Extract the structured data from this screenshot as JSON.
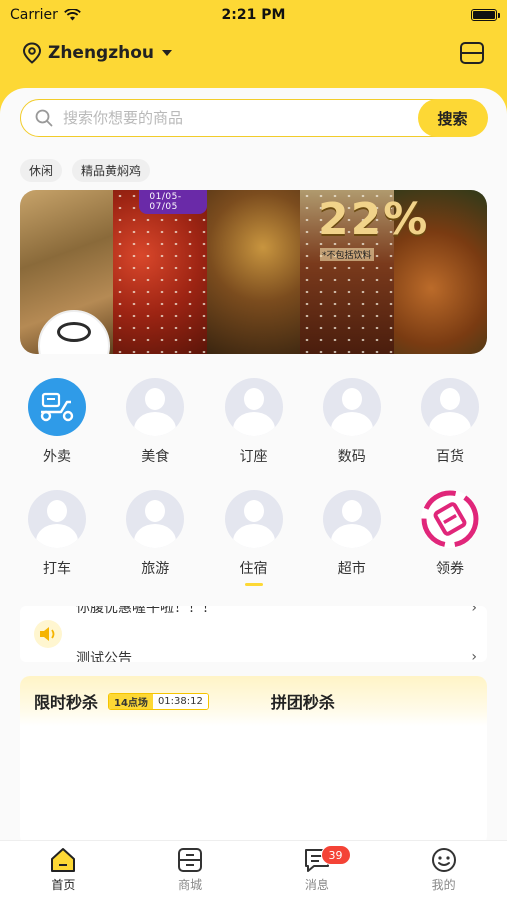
{
  "status_bar": {
    "carrier": "Carrier",
    "time": "2:21 PM"
  },
  "header": {
    "location": "Zhengzhou"
  },
  "search": {
    "placeholder": "搜索你想要的商品",
    "button_label": "搜索"
  },
  "tags": [
    "休闲",
    "精品黄焖鸡"
  ],
  "banner": {
    "date_range": "01/05-07/05",
    "discount": "22%",
    "discount_note": "*不包括饮料"
  },
  "categories": [
    {
      "label": "外卖",
      "icon": "scooter-icon"
    },
    {
      "label": "美食",
      "icon": "avatar-placeholder"
    },
    {
      "label": "订座",
      "icon": "avatar-placeholder"
    },
    {
      "label": "数码",
      "icon": "avatar-placeholder"
    },
    {
      "label": "百货",
      "icon": "avatar-placeholder"
    },
    {
      "label": "打车",
      "icon": "avatar-placeholder"
    },
    {
      "label": "旅游",
      "icon": "avatar-placeholder"
    },
    {
      "label": "住宿",
      "icon": "avatar-placeholder"
    },
    {
      "label": "超市",
      "icon": "avatar-placeholder"
    },
    {
      "label": "领券",
      "icon": "coupon-icon"
    }
  ],
  "notice": {
    "line1": "你腹优惠喔牛啦！！！",
    "line2": "测试公告"
  },
  "seckill": {
    "title": "限时秒杀",
    "session_label": "14点场",
    "countdown": "01:38:12",
    "group_title": "拼团秒杀"
  },
  "tabbar": {
    "home": "首页",
    "mall": "商城",
    "messages": "消息",
    "messages_badge": "39",
    "mine": "我的"
  },
  "colors": {
    "brand_yellow": "#fdd835",
    "badge_red": "#f44336",
    "waimai_blue": "#2f9be8",
    "coupon_pink": "#e0267a"
  }
}
